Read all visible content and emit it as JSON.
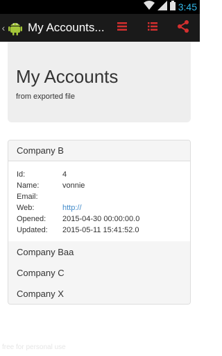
{
  "status_bar": {
    "time": "3:45",
    "icons": [
      "wifi-icon",
      "signal-icon",
      "battery-icon"
    ]
  },
  "action_bar": {
    "title": "My Accounts...",
    "buttons": [
      "menu-icon",
      "list-icon",
      "share-icon"
    ],
    "accent_color": "#d32f2f"
  },
  "header": {
    "title": "My Accounts",
    "subtitle": "from exported file"
  },
  "accounts": {
    "expanded": {
      "name": "Company B",
      "details": [
        {
          "label": "Id:",
          "value": "4"
        },
        {
          "label": "Name:",
          "value": "vonnie"
        },
        {
          "label": "Email:",
          "value": ""
        },
        {
          "label": "Web:",
          "value": "http://"
        },
        {
          "label": "Opened:",
          "value": "2015-04-30 00:00:00.0"
        },
        {
          "label": "Updated:",
          "value": "2015-05-11 15:41:52.0"
        }
      ]
    },
    "collapsed": [
      "Company Baa",
      "Company C",
      "Company X"
    ]
  },
  "footer": {
    "watermark": "free for personal use"
  }
}
